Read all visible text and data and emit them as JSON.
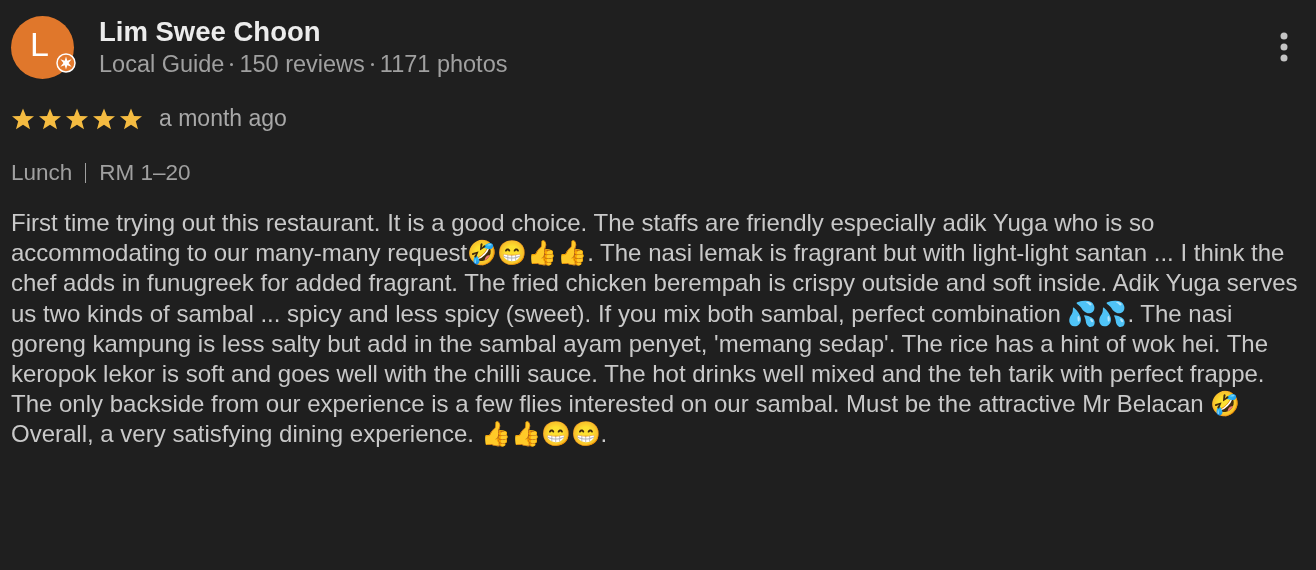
{
  "reviewer": {
    "initial": "L",
    "name": "Lim Swee Choon",
    "meta": [
      "Local Guide",
      "150 reviews",
      "1171 photos"
    ],
    "local_guide": true
  },
  "stars": 5,
  "time": "a month ago",
  "tags": [
    "Lunch",
    "RM 1–20"
  ],
  "text": "First time trying out this restaurant. It is a good choice. The staffs are friendly especially adik Yuga who is so accommodating to our many-many request🤣😁👍👍. The nasi lemak is fragrant but with light-light santan ... I think the chef adds in funugreek for added fragrant. The fried chicken berempah is crispy outside and soft inside. Adik Yuga serves us two kinds of sambal ... spicy and less spicy (sweet). If you mix both sambal, perfect combination 💦💦. The nasi goreng kampung is less salty but add in the sambal ayam penyet, 'memang sedap'. The rice has a hint of wok hei. The keropok lekor is soft and goes well with the chilli sauce. The hot drinks well mixed and the teh tarik with perfect frappe. The only backside from our experience is a few flies interested on our sambal. Must be the attractive Mr Belacan 🤣 Overall, a very satisfying dining experience. 👍👍😁😁."
}
